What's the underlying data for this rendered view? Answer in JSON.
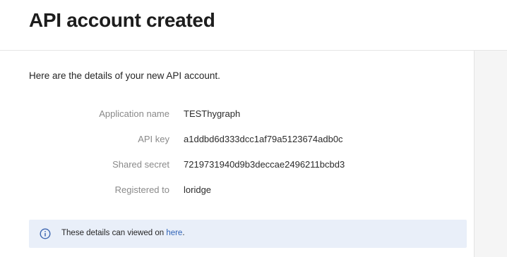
{
  "header": {
    "title": "API account created"
  },
  "intro": "Here are the details of your new API account.",
  "details": [
    {
      "label": "Application name",
      "value": "TESThygraph"
    },
    {
      "label": "API key",
      "value": "a1ddbd6d333dcc1af79a5123674adb0c"
    },
    {
      "label": "Shared secret",
      "value": "7219731940d9b3deccae2496211bcbd3"
    },
    {
      "label": "Registered to",
      "value": "loridge"
    }
  ],
  "notice": {
    "icon": "info-icon",
    "text_before": "These details can viewed on ",
    "link_text": "here",
    "text_after": "."
  },
  "colors": {
    "notice_background": "#e9eff9",
    "link": "#2f63b7",
    "icon": "#3e67b1"
  }
}
